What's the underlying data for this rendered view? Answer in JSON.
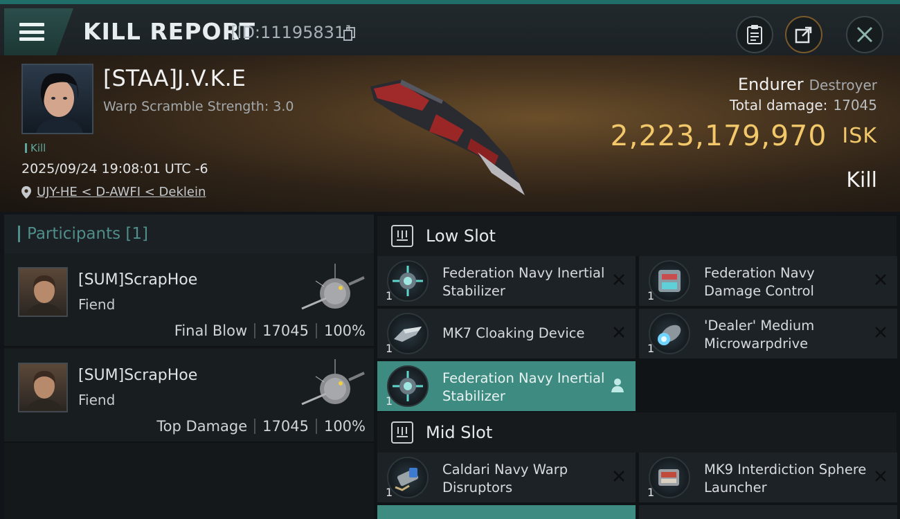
{
  "header": {
    "title": "KILL REPORT",
    "report_id": "[ID:11195831]"
  },
  "victim": {
    "pilot_name": "[STAA]J.V.K.E",
    "warp_scramble": "Warp Scramble Strength: 3.0",
    "kill_tag": "Kill",
    "datetime": "2025/09/24 19:08:01 UTC -6",
    "location": "UJY-HE < D-AWFI < Deklein",
    "ship_name": "Endurer",
    "ship_class": "Destroyer",
    "total_damage_label": "Total damage:",
    "total_damage": "17045",
    "isk_value": "2,223,179,970",
    "isk_unit": "ISK",
    "result": "Kill"
  },
  "participants": {
    "label": "Participants [1]",
    "items": [
      {
        "name": "[SUM]ScrapHoe",
        "ship": "Fiend",
        "role": "Final Blow",
        "damage": "17045",
        "percent": "100%"
      },
      {
        "name": "[SUM]ScrapHoe",
        "ship": "Fiend",
        "role": "Top Damage",
        "damage": "17045",
        "percent": "100%"
      }
    ]
  },
  "slots": {
    "low": {
      "label": "Low Slot",
      "modules": [
        {
          "name": "Federation Navy Inertial Stabilizer",
          "qty": "1",
          "icon": "inertial-stabilizer-icon"
        },
        {
          "name": "Federation Navy Damage Control",
          "qty": "1",
          "icon": "damage-control-icon"
        },
        {
          "name": "MK7 Cloaking Device",
          "qty": "1",
          "icon": "cloaking-device-icon"
        },
        {
          "name": "'Dealer' Medium Microwarpdrive",
          "qty": "1",
          "icon": "microwarpdrive-icon"
        },
        {
          "name": "Federation Navy Inertial Stabilizer",
          "qty": "1",
          "icon": "inertial-stabilizer-icon"
        }
      ]
    },
    "mid": {
      "label": "Mid Slot",
      "modules": [
        {
          "name": "Caldari Navy Warp Disruptors",
          "qty": "1",
          "icon": "warp-disruptor-icon"
        },
        {
          "name": "MK9 Interdiction Sphere Launcher",
          "qty": "1",
          "icon": "sphere-launcher-icon"
        }
      ]
    }
  },
  "colors": {
    "accent": "#3d8b81",
    "isk": "#f2c86b"
  }
}
